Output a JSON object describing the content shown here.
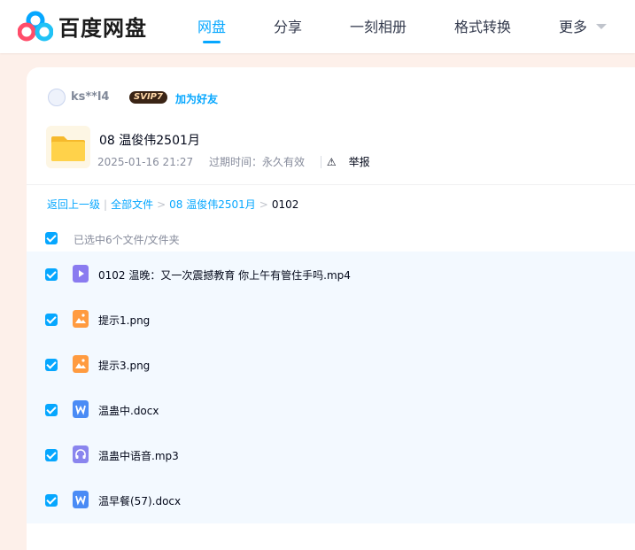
{
  "header": {
    "logo_text": "百度网盘",
    "nav": [
      {
        "label": "网盘",
        "active": true
      },
      {
        "label": "分享",
        "active": false
      },
      {
        "label": "一刻相册",
        "active": false
      },
      {
        "label": "格式转换",
        "active": false
      },
      {
        "label": "更多",
        "active": false
      }
    ]
  },
  "share": {
    "username": "ks**l4",
    "badge": "SVIP7",
    "add_friend": "加为好友",
    "title": "08 温俊伟2501月",
    "date": "2025-01-16 21:27",
    "expire": "过期时间：永久有效",
    "report": "举报"
  },
  "breadcrumb": {
    "back": "返回上一级",
    "all_files": "全部文件",
    "folder": "08 温俊伟2501月",
    "current": "0102"
  },
  "selection": {
    "label": "已选中6个文件/文件夹"
  },
  "files": [
    {
      "name": "0102 温晚：又一次震撼教育 你上午有管住手吗.mp4",
      "type": "video",
      "icon": "video-file-icon"
    },
    {
      "name": "提示1.png",
      "type": "image",
      "icon": "image-file-icon"
    },
    {
      "name": "提示3.png",
      "type": "image",
      "icon": "image-file-icon"
    },
    {
      "name": "温蛊中.docx",
      "type": "word",
      "icon": "word-file-icon"
    },
    {
      "name": "温蛊中语音.mp3",
      "type": "audio",
      "icon": "audio-file-icon"
    },
    {
      "name": "温早餐(57).docx",
      "type": "word",
      "icon": "word-file-icon"
    }
  ],
  "colors": {
    "accent": "#06a7ff",
    "background": "#fdf0ea",
    "selected_row": "#f3f9ff",
    "video": "#8a7bf0",
    "image": "#ff9b40",
    "word": "#4a8bf5",
    "audio": "#8a85ee"
  }
}
